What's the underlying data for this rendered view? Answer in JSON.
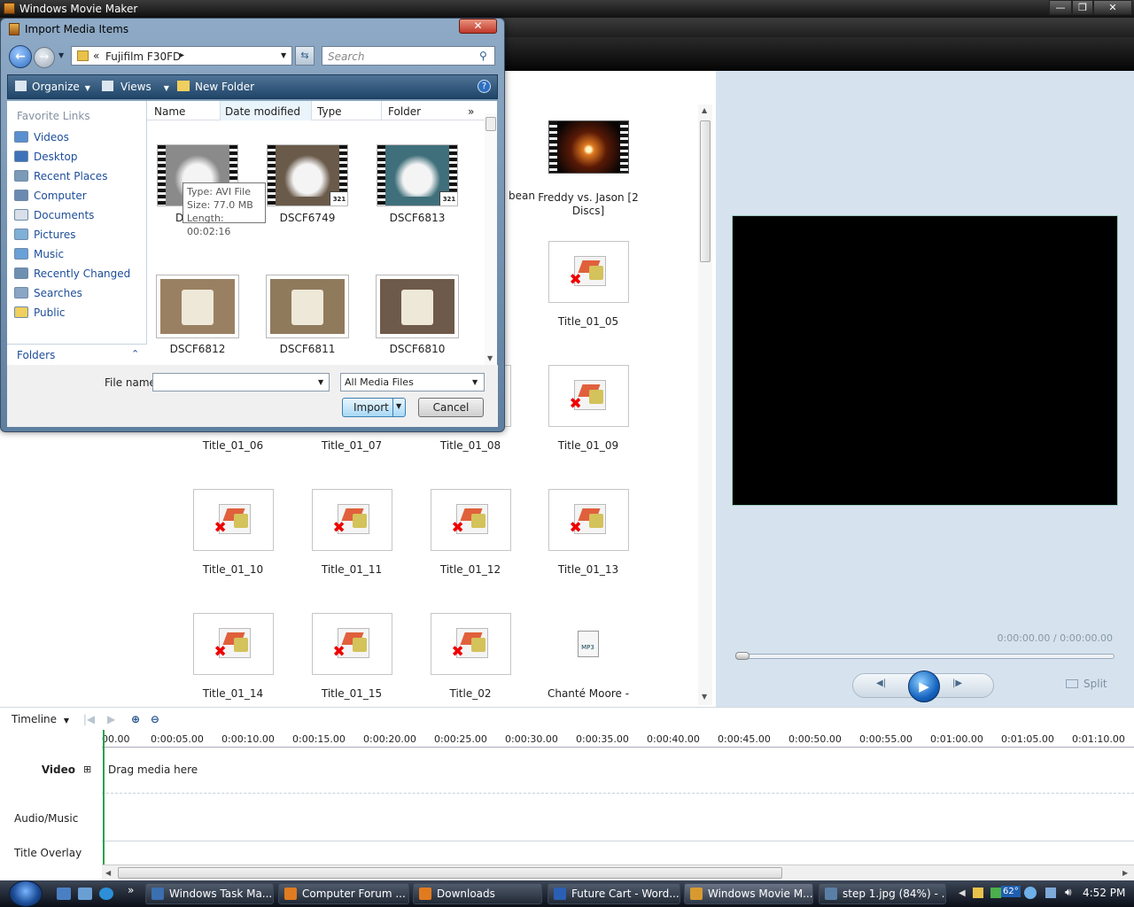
{
  "app": {
    "title": "Windows Movie Maker",
    "min": "—",
    "max": "❐",
    "close": "✕"
  },
  "dialog": {
    "title": "Import Media Items",
    "close": "✕",
    "address": {
      "prefix": "«",
      "location": "Fujifilm F30FD",
      "arrow": "▸"
    },
    "search_placeholder": "Search",
    "commands": {
      "organize": "Organize",
      "views": "Views",
      "new_folder": "New Folder",
      "help": "?"
    },
    "favorite_links_title": "Favorite Links",
    "favorite_links": [
      "Videos",
      "Desktop",
      "Recent Places",
      "Computer",
      "Documents",
      "Pictures",
      "Music",
      "Recently Changed",
      "Searches",
      "Public"
    ],
    "folders_label": "Folders",
    "columns": [
      "Name",
      "Date modified",
      "Type",
      "Folder"
    ],
    "files": [
      {
        "name": "D",
        "kind": "video",
        "bg": "#8a8a8a"
      },
      {
        "name": "DSCF6749",
        "kind": "video",
        "bg": "#6a5a4a"
      },
      {
        "name": "DSCF6813",
        "kind": "video",
        "bg": "#3f6f7a"
      },
      {
        "name": "DSCF6812",
        "kind": "photo",
        "bg": "#9a8062"
      },
      {
        "name": "DSCF6811",
        "kind": "photo",
        "bg": "#8f7a5c"
      },
      {
        "name": "DSCF6810",
        "kind": "photo",
        "bg": "#6e5a4a"
      }
    ],
    "badge": "321",
    "tooltip": {
      "type": "Type: AVI File",
      "size": "Size: 77.0 MB",
      "length": "Length: 00:02:16"
    },
    "file_name_label": "File name:",
    "file_name_value": "",
    "file_type": "All Media Files",
    "import_label": "Import",
    "cancel_label": "Cancel"
  },
  "collection": [
    {
      "name": "bean",
      "kind": "partial"
    },
    {
      "name": "Freddy vs. Jason [2 Discs]",
      "kind": "video"
    },
    {
      "name": "Title_01_05",
      "kind": "title"
    },
    {
      "name": "Title_01_06",
      "kind": "title"
    },
    {
      "name": "Title_01_07",
      "kind": "title"
    },
    {
      "name": "Title_01_08",
      "kind": "title"
    },
    {
      "name": "Title_01_09",
      "kind": "title"
    },
    {
      "name": "Title_01_10",
      "kind": "title"
    },
    {
      "name": "Title_01_11",
      "kind": "title"
    },
    {
      "name": "Title_01_12",
      "kind": "title"
    },
    {
      "name": "Title_01_13",
      "kind": "title"
    },
    {
      "name": "Title_01_14",
      "kind": "title"
    },
    {
      "name": "Title_01_15",
      "kind": "title"
    },
    {
      "name": "Title_02",
      "kind": "title"
    },
    {
      "name": "Chanté Moore -",
      "kind": "mp3"
    }
  ],
  "mp3_label": "MP3",
  "preview": {
    "timecode": "0:00:00.00 / 0:00:00.00",
    "split_label": "Split",
    "play": "▶",
    "prev": "◀|",
    "next": "|▶"
  },
  "timeline": {
    "label": "Timeline",
    "ticks": [
      "00.00",
      "0:00:05.00",
      "0:00:10.00",
      "0:00:15.00",
      "0:00:20.00",
      "0:00:25.00",
      "0:00:30.00",
      "0:00:35.00",
      "0:00:40.00",
      "0:00:45.00",
      "0:00:50.00",
      "0:00:55.00",
      "0:01:00.00",
      "0:01:05.00",
      "0:01:10.00"
    ],
    "video_label": "Video",
    "expand": "⊞",
    "drag_hint": "Drag media here",
    "audio_label": "Audio/Music",
    "title_label": "Title Overlay"
  },
  "taskbar": {
    "more": "»",
    "items": [
      "Windows Task Ma...",
      "Computer Forum ...",
      "Downloads",
      "Future Cart - Word...",
      "Windows Movie M...",
      "step 1.jpg (84%) - ..."
    ],
    "temp": "62°",
    "clock": "4:52 PM"
  }
}
